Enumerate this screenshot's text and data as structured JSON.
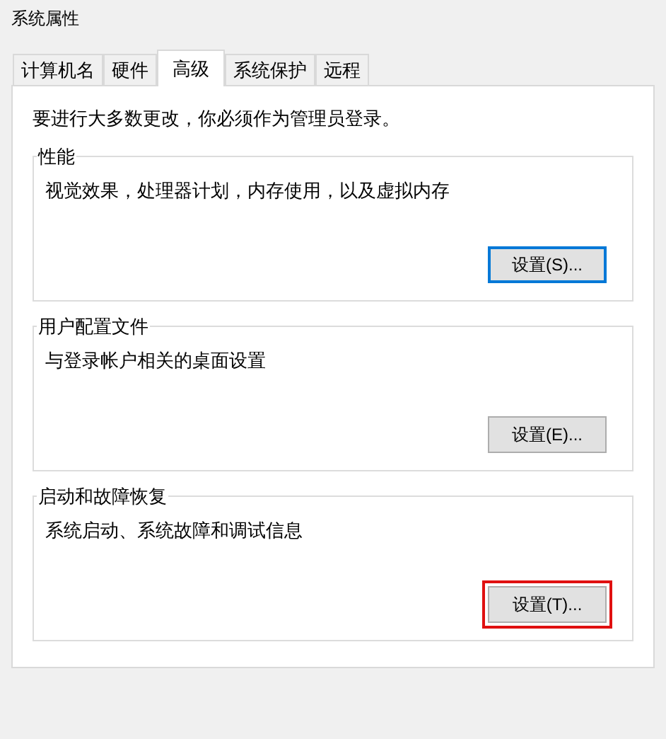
{
  "window": {
    "title": "系统属性"
  },
  "tabs": [
    {
      "label": "计算机名",
      "selected": false
    },
    {
      "label": "硬件",
      "selected": false
    },
    {
      "label": "高级",
      "selected": true
    },
    {
      "label": "系统保护",
      "selected": false
    },
    {
      "label": "远程",
      "selected": false
    }
  ],
  "notice": "要进行大多数更改，你必须作为管理员登录。",
  "groups": [
    {
      "title": "性能",
      "description": "视觉效果，处理器计划，内存使用，以及虚拟内存",
      "button": {
        "label": "设置(S)...",
        "focused": true,
        "highlighted": false
      }
    },
    {
      "title": "用户配置文件",
      "description": "与登录帐户相关的桌面设置",
      "button": {
        "label": "设置(E)...",
        "focused": false,
        "highlighted": false
      }
    },
    {
      "title": "启动和故障恢复",
      "description": "系统启动、系统故障和调试信息",
      "button": {
        "label": "设置(T)...",
        "focused": false,
        "highlighted": true
      }
    }
  ]
}
